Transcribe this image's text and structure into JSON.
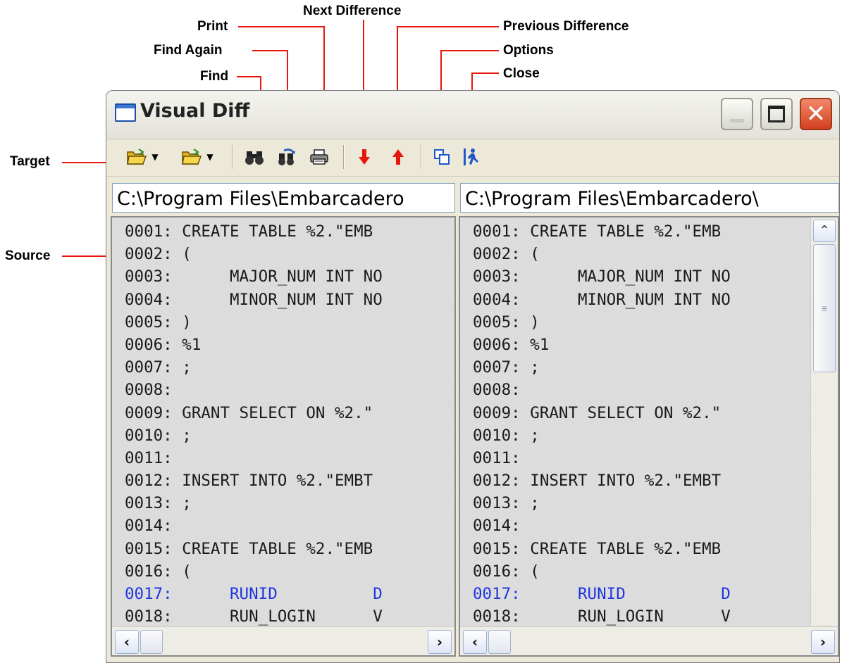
{
  "window": {
    "title": "Visual Diff",
    "close_glyph": "✕"
  },
  "callouts": {
    "print": "Print",
    "find_again": "Find Again",
    "find": "Find",
    "next_difference": "Next Difference",
    "previous_difference": "Previous Difference",
    "options": "Options",
    "close": "Close",
    "target": "Target",
    "source": "Source"
  },
  "toolbar": {
    "icons": [
      "open-folder-icon",
      "dropdown-arrow-icon",
      "open-folder-icon",
      "dropdown-arrow-icon",
      "binoculars-icon",
      "find-again-icon",
      "printer-icon",
      "down-arrow-icon",
      "up-arrow-icon",
      "options-icon",
      "exit-icon"
    ],
    "dropdown_glyph": "▼",
    "accent_red": "#e8160c"
  },
  "left_pane": {
    "path": "C:\\Program Files\\Embarcadero",
    "lines": [
      "0001: CREATE TABLE %2.\"EMB",
      "0002: (",
      "0003:      MAJOR_NUM INT NO",
      "0004:      MINOR_NUM INT NO",
      "0005: )",
      "0006: %1",
      "0007: ;",
      "0008:",
      "0009: GRANT SELECT ON %2.\"",
      "0010: ;",
      "0011:",
      "0012: INSERT INTO %2.\"EMBT",
      "0013: ;",
      "0014:",
      "0015: CREATE TABLE %2.\"EMB",
      "0016: (",
      "0017:      RUNID          D",
      "0018:      RUN_LOGIN      V"
    ]
  },
  "right_pane": {
    "path": "C:\\Program Files\\Embarcadero\\",
    "lines": [
      "0001: CREATE TABLE %2.\"EMB",
      "0002: (",
      "0003:      MAJOR_NUM INT NO",
      "0004:      MINOR_NUM INT NO",
      "0005: )",
      "0006: %1",
      "0007: ;",
      "0008:",
      "0009: GRANT SELECT ON %2.\"",
      "0010: ;",
      "0011:",
      "0012: INSERT INTO %2.\"EMBT",
      "0013: ;",
      "0014:",
      "0015: CREATE TABLE %2.\"EMB",
      "0016: (",
      "0017:      RUNID          D",
      "0018:      RUN_LOGIN      V"
    ]
  },
  "difference_line_color": "#1f35e0",
  "scrollbars": {
    "up": "⌃",
    "grip": "≡",
    "left": "‹",
    "right": "›"
  }
}
